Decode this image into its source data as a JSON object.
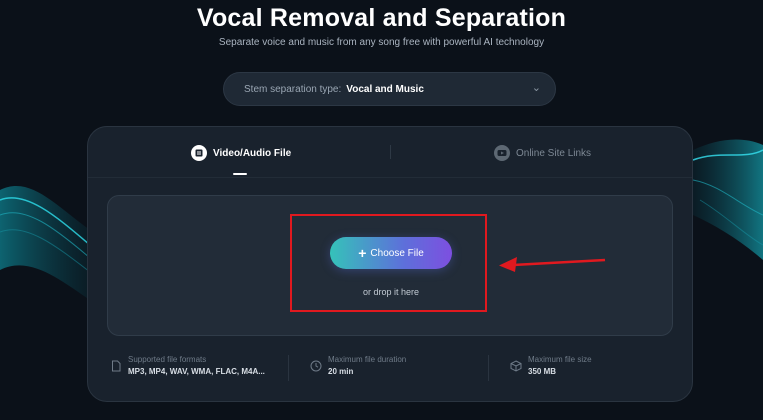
{
  "header": {
    "title": "Vocal Removal and Separation",
    "subtitle": "Separate voice and music from any song free with powerful AI technology"
  },
  "stem_select": {
    "label": "Stem separation type:",
    "value": "Vocal and Music"
  },
  "tabs": [
    {
      "label": "Video/Audio File",
      "icon": "file-icon",
      "active": true
    },
    {
      "label": "Online Site Links",
      "icon": "youtube-icon",
      "active": false
    }
  ],
  "upload": {
    "button_label": "Choose File",
    "drop_text": "or drop it here"
  },
  "info": [
    {
      "label": "Supported file formats",
      "value": "MP3, MP4, WAV, WMA, FLAC, M4A...",
      "icon": "file-outline-icon"
    },
    {
      "label": "Maximum file duration",
      "value": "20 min",
      "icon": "clock-icon"
    },
    {
      "label": "Maximum file size",
      "value": "350 MB",
      "icon": "cube-icon"
    }
  ],
  "annotation_colors": {
    "highlight": "#e0191f",
    "accent_start": "#35c2b9",
    "accent_end": "#7d4fe0"
  }
}
